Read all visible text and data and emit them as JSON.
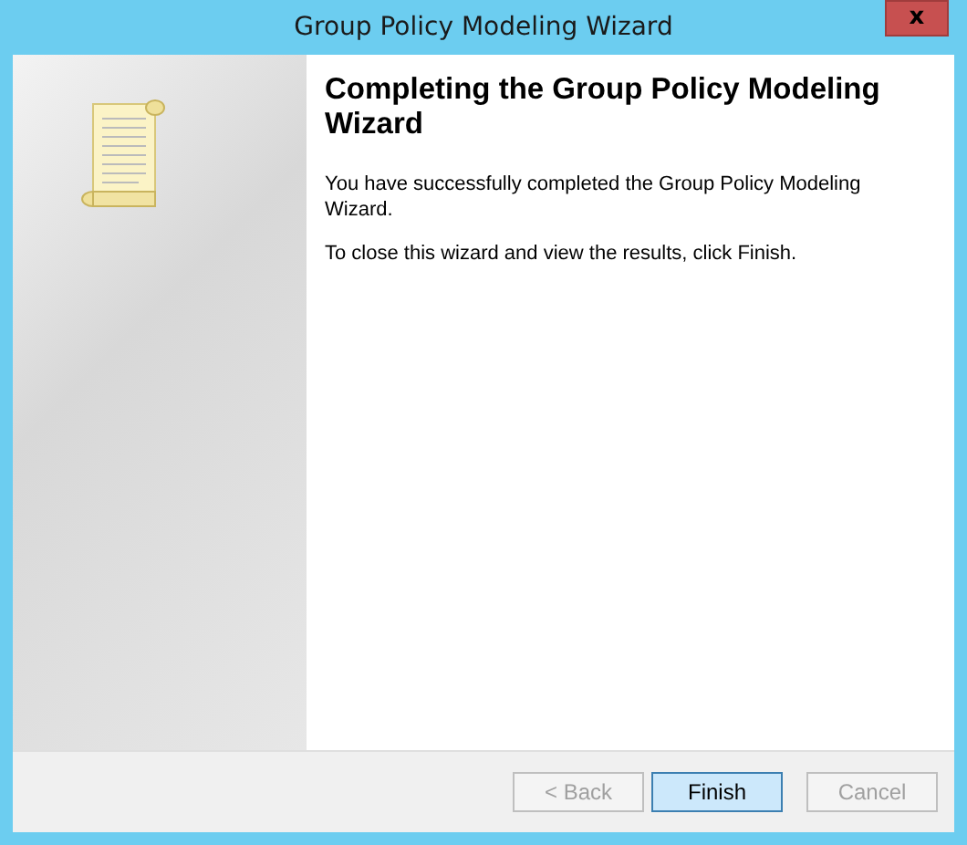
{
  "window": {
    "title": "Group Policy Modeling Wizard",
    "close": "x"
  },
  "heading": "Completing the Group Policy Modeling Wizard",
  "paragraphs": [
    "You have successfully completed the Group Policy Modeling Wizard.",
    "To close this wizard and view the results, click Finish."
  ],
  "buttons": [
    {
      "label": "< Back",
      "disabled": true,
      "default": false
    },
    {
      "label": "Finish",
      "disabled": false,
      "default": true
    },
    {
      "label": "Cancel",
      "disabled": true,
      "default": false
    }
  ]
}
